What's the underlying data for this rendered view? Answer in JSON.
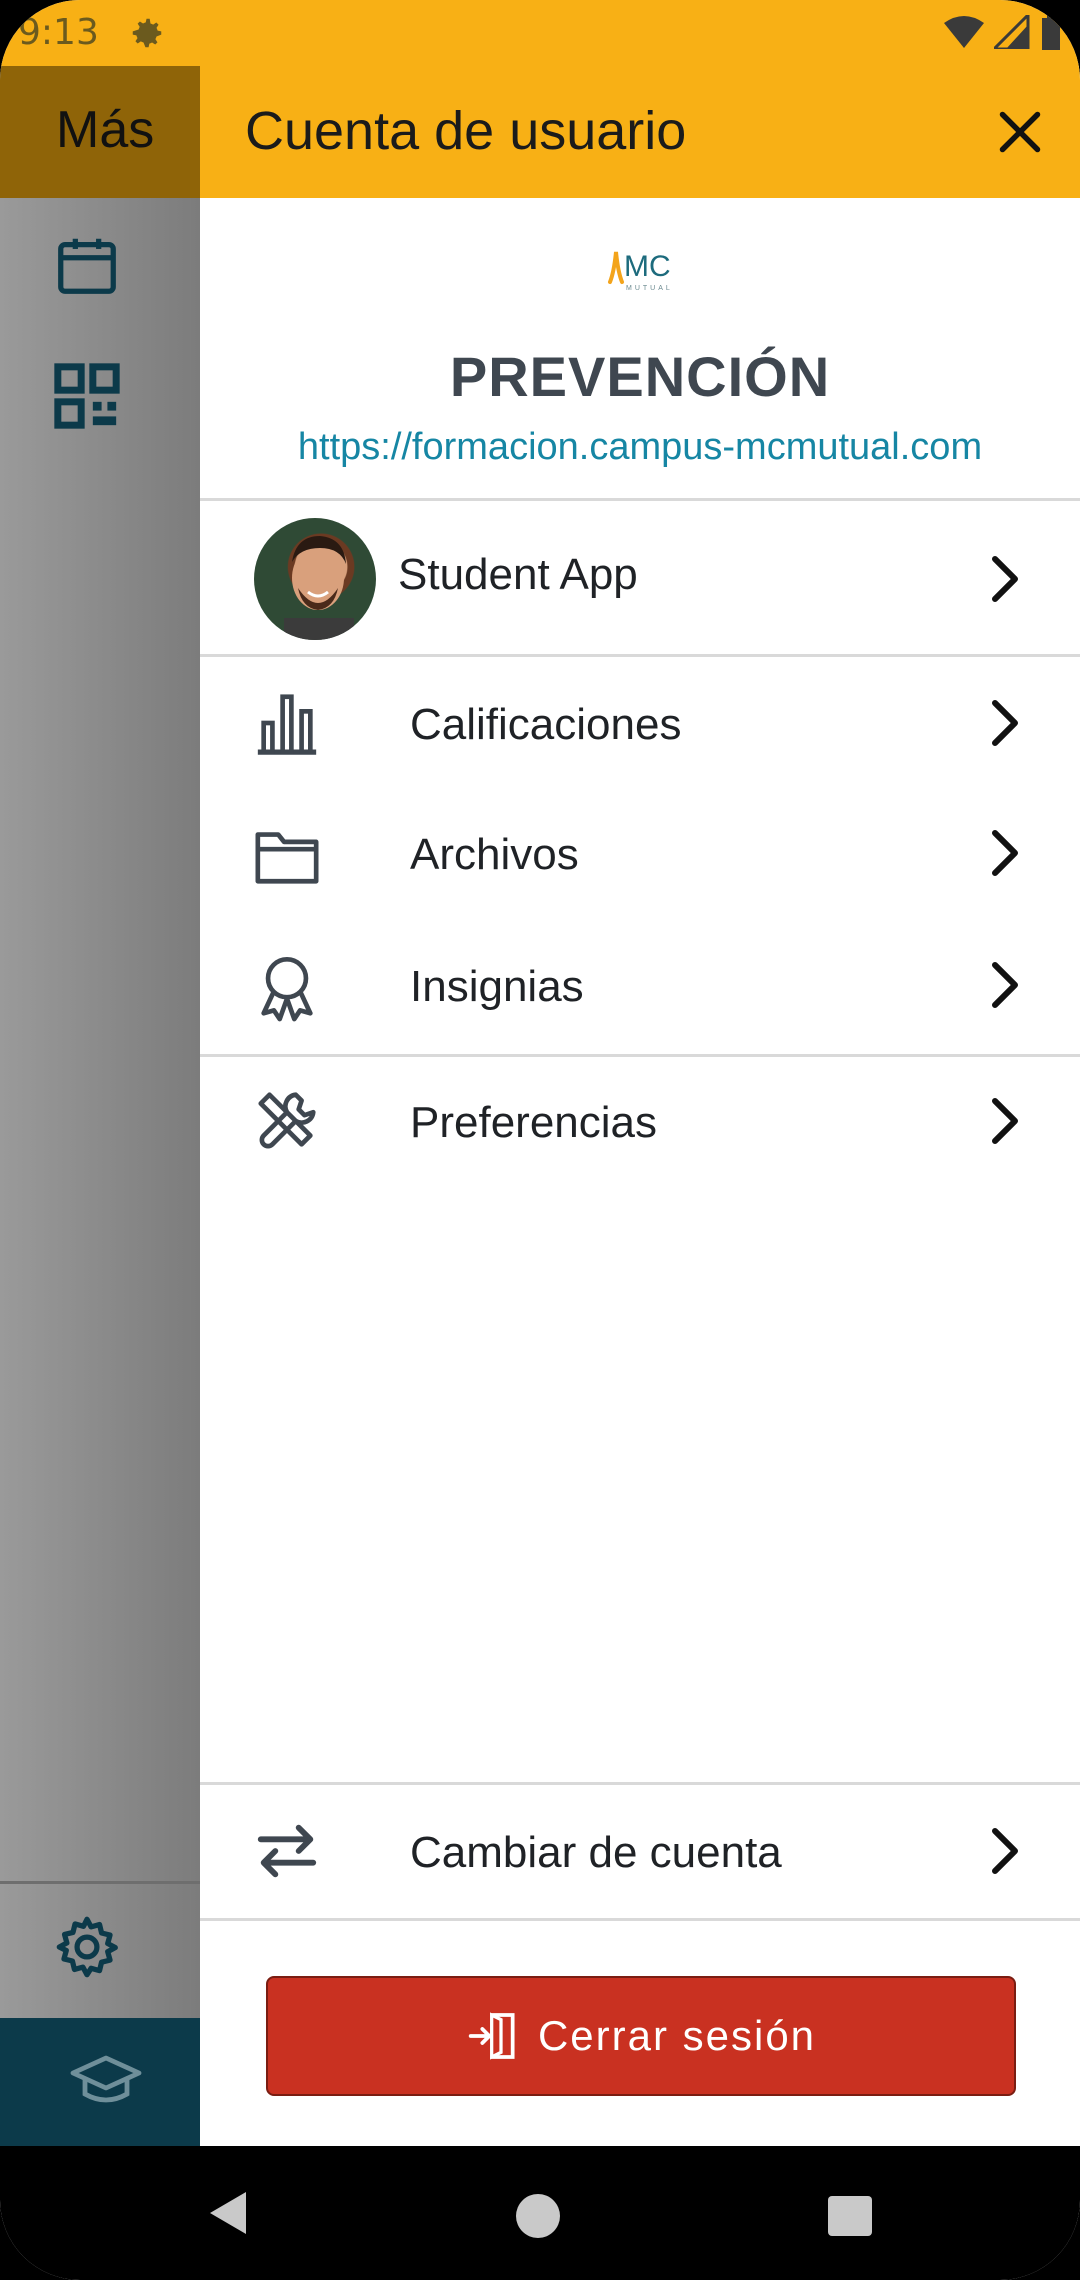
{
  "status_bar": {
    "time": "9:13"
  },
  "background_screen": {
    "title": "Más"
  },
  "drawer": {
    "title": "Cuenta de usuario",
    "site_name": "PREVENCIÓN",
    "site_url": "https://formacion.campus-mcmutual.com",
    "user": {
      "name": "Student App"
    },
    "menu_items": [
      {
        "label": "Calificaciones",
        "icon": "bar-chart-icon"
      },
      {
        "label": "Archivos",
        "icon": "folder-icon"
      },
      {
        "label": "Insignias",
        "icon": "badge-icon"
      },
      {
        "label": "Preferencias",
        "icon": "tools-icon"
      }
    ],
    "switch_account": {
      "label": "Cambiar de cuenta",
      "icon": "swap-arrows-icon"
    },
    "logout": {
      "label": "Cerrar sesión",
      "icon": "logout-icon"
    }
  },
  "colors": {
    "accent_yellow": "#f8b015",
    "logout_red": "#c93121",
    "link_blue": "#1686a4",
    "dark_teal": "#0c3a4a"
  }
}
